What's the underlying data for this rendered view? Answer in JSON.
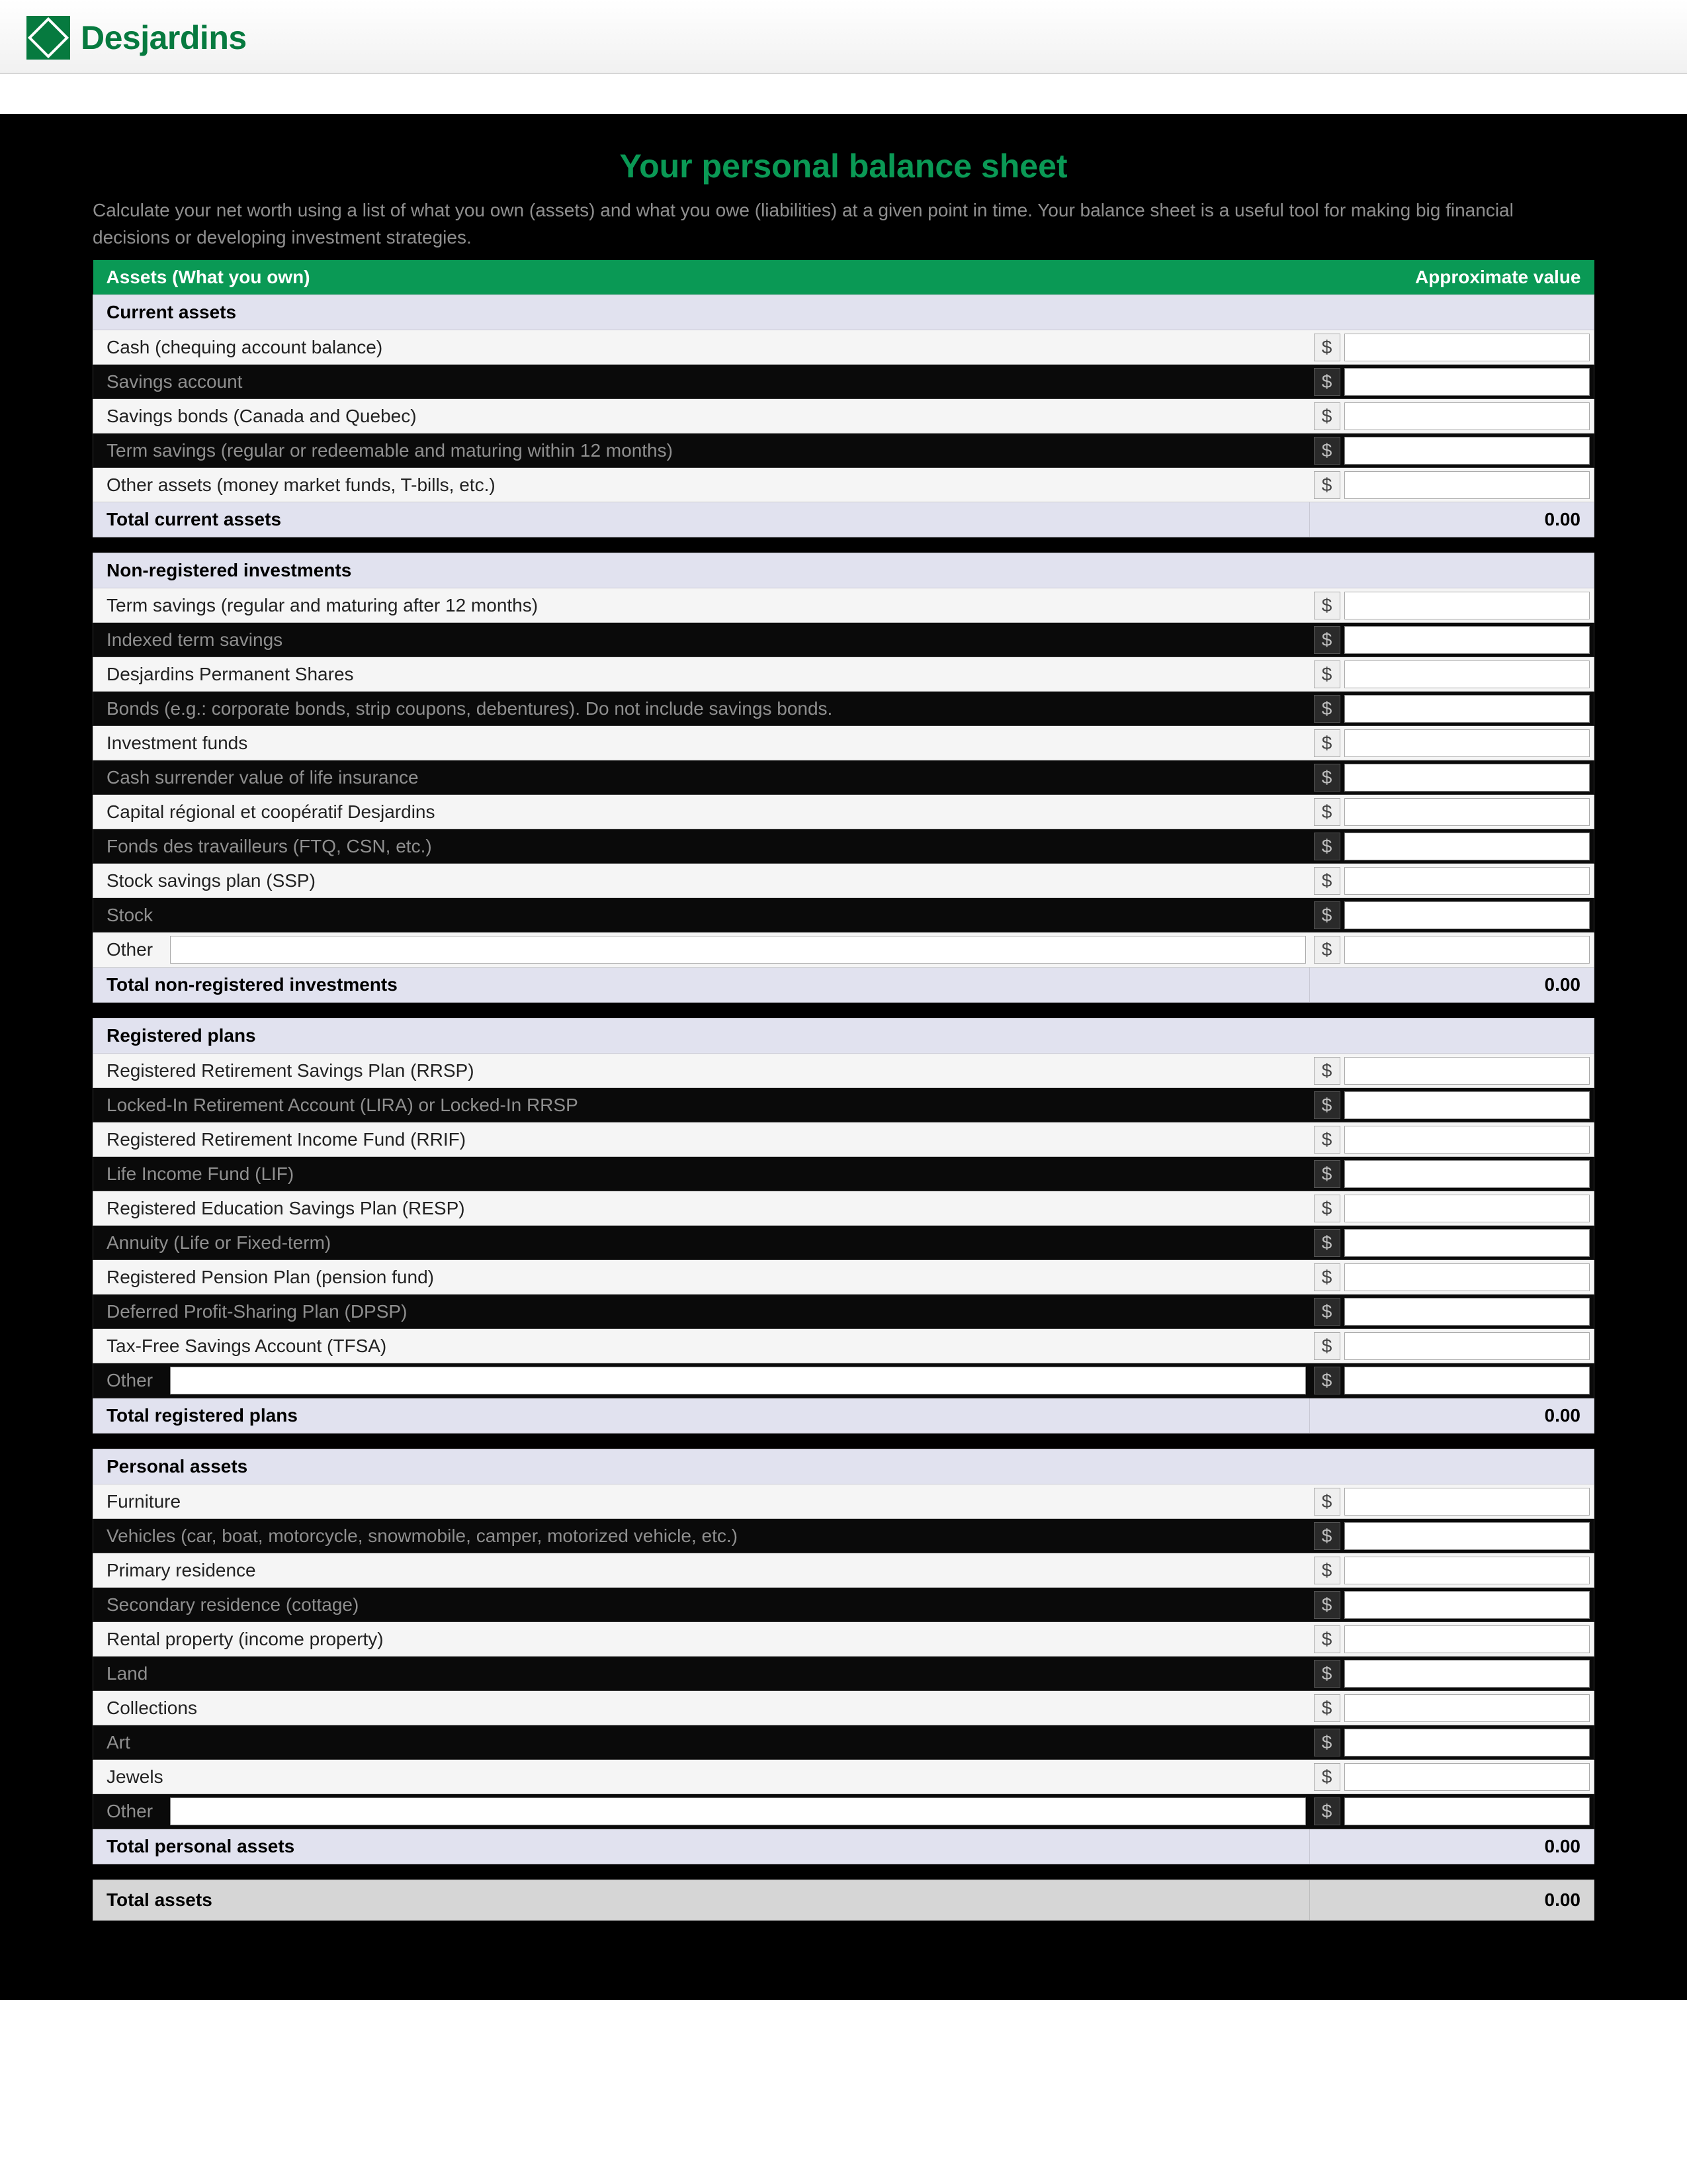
{
  "brand": "Desjardins",
  "page_title": "Your personal balance sheet",
  "intro": "Calculate your net worth using a list of what you own (assets) and what you owe (liabilities) at a given point in time. Your balance sheet is a useful tool for making big financial decisions or developing investment strategies.",
  "dollar_sign": "$",
  "header_assets": "Assets (What you own)",
  "header_value": "Approximate value",
  "sections": {
    "current": {
      "title": "Current assets",
      "items": [
        "Cash (chequing account balance)",
        "Savings account",
        "Savings bonds (Canada and Quebec)",
        "Term savings (regular or redeemable and maturing within 12 months)",
        "Other assets (money market funds, T-bills, etc.)"
      ],
      "total_label": "Total current assets",
      "total_value": "0.00"
    },
    "nonreg": {
      "title": "Non-registered investments",
      "items": [
        "Term savings (regular and maturing after 12 months)",
        "Indexed term savings",
        "Desjardins Permanent Shares",
        "Bonds (e.g.: corporate bonds, strip coupons, debentures). Do not include savings bonds.",
        "Investment funds",
        "Cash surrender value of life insurance",
        "Capital régional et coopératif Desjardins",
        "Fonds des travailleurs (FTQ, CSN, etc.)",
        "Stock savings plan (SSP)",
        "Stock"
      ],
      "other_label": "Other",
      "total_label": "Total non-registered investments",
      "total_value": "0.00"
    },
    "reg": {
      "title": "Registered plans",
      "items": [
        "Registered Retirement Savings Plan (RRSP)",
        "Locked-In Retirement Account (LIRA) or Locked-In RRSP",
        "Registered Retirement Income Fund (RRIF)",
        "Life Income Fund (LIF)",
        "Registered Education Savings Plan (RESP)",
        "Annuity (Life or Fixed-term)",
        "Registered Pension Plan (pension fund)",
        "Deferred Profit-Sharing Plan (DPSP)",
        "Tax-Free Savings Account (TFSA)"
      ],
      "other_label": "Other",
      "total_label": "Total registered plans",
      "total_value": "0.00"
    },
    "personal": {
      "title": "Personal assets",
      "items": [
        "Furniture",
        "Vehicles (car, boat, motorcycle, snowmobile, camper, motorized vehicle, etc.)",
        "Primary residence",
        "Secondary residence (cottage)",
        "Rental property (income property)",
        "Land",
        "Collections",
        "Art",
        "Jewels"
      ],
      "other_label": "Other",
      "total_label": "Total personal assets",
      "total_value": "0.00"
    }
  },
  "grand_total_label": "Total assets",
  "grand_total_value": "0.00"
}
